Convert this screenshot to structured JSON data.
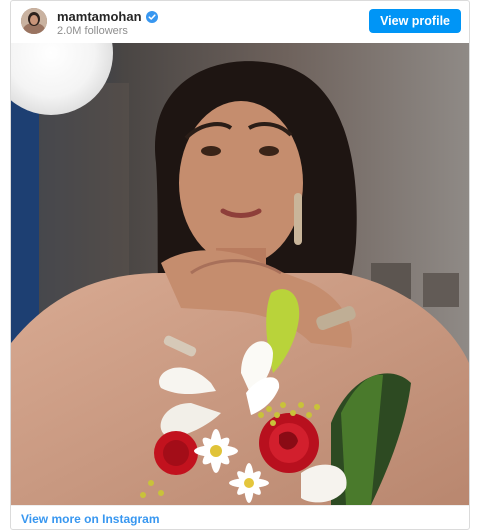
{
  "header": {
    "username": "mamtamohan",
    "followers": "2.0M followers",
    "view_profile_label": "View profile"
  },
  "footer": {
    "view_more_label": "View more on Instagram"
  },
  "colors": {
    "accent": "#0095f6",
    "link": "#3897f0"
  },
  "icons": {
    "verified": "verified-badge-icon"
  }
}
